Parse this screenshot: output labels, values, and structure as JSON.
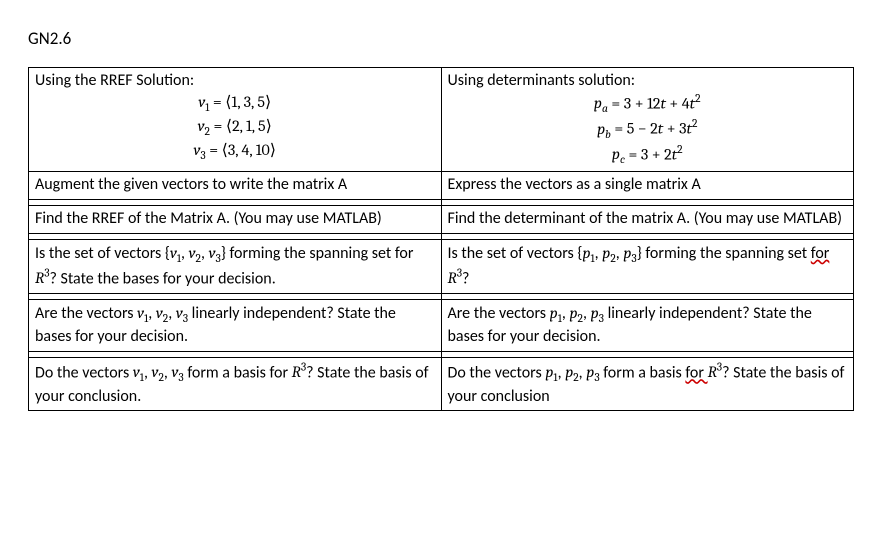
{
  "title": "GN2.6",
  "left": {
    "header_lead": "Using the RREF Solution:",
    "eq1_lhs": "v",
    "eq1_sub": "1",
    "eq1_rhs": " = ⟨1, 3, 5⟩",
    "eq2_lhs": "v",
    "eq2_sub": "2",
    "eq2_rhs": " = ⟨2, 1, 5⟩",
    "eq3_lhs": "v",
    "eq3_sub": "3",
    "eq3_rhs": " = ⟨3, 4, 10⟩",
    "row2": "Augment the given vectors to write the matrix A",
    "row3": "Find the RREF of the Matrix A. (You may use MATLAB)",
    "row4_pre": "Is the set of vectors ",
    "row4_set_open": "{",
    "row4_v1": "v",
    "row4_v1_sub": "1",
    "row4_sep": ", ",
    "row4_v2": "v",
    "row4_v2_sub": "2",
    "row4_v3": "v",
    "row4_v3_sub": "3",
    "row4_set_close": "}",
    "row4_post1": "  forming the spanning set for ",
    "row4_R": "R",
    "row4_R_sup": "3",
    "row4_post2": "? State the bases for your decision.",
    "row5_pre": "Are the vectors ",
    "row5_post": " linearly independent? State the bases for your decision.",
    "row6_pre": "Do the vectors ",
    "row6_mid": " form a basis for ",
    "row6_post": "? State the basis of your conclusion."
  },
  "right": {
    "header_lead": "Using determinants solution:",
    "eq1_lhs": "p",
    "eq1_sub": "a",
    "eq1_rhs_a": " = 3 + 12",
    "eq1_t1": "t",
    "eq1_rhs_b": " + 4",
    "eq1_t2": "t",
    "eq1_sup": "2",
    "eq2_lhs": "p",
    "eq2_sub": "b",
    "eq2_rhs_a": " = 5 − 2",
    "eq2_t1": "t",
    "eq2_rhs_b": " + 3",
    "eq2_t2": "t",
    "eq2_sup": "2",
    "eq3_lhs": "p",
    "eq3_sub": "c",
    "eq3_rhs_a": " = 3 + 2",
    "eq3_t1": "t",
    "eq3_sup": "2",
    "row2": "Express the vectors as a single matrix A",
    "row3": "Find the determinant of the matrix A. (You may use MATLAB)",
    "row4_pre": "Is the set of vectors ",
    "row4_set_open": "{",
    "row4_p1": "p",
    "row4_p1_sub": "1",
    "row4_sep": ", ",
    "row4_p2": "p",
    "row4_p2_sub": "2",
    "row4_p3": "p",
    "row4_p3_sub": "3",
    "row4_set_close": "}",
    "row4_post1": " forming the spanning set ",
    "row4_for": "for ",
    "row4_R": "R",
    "row4_R_sup": "3",
    "row4_post2": "?",
    "row5_pre": "Are the vectors ",
    "row5_post": " linearly independent? State the bases for your decision.",
    "row6_pre": "Do the vectors ",
    "row6_mid": " form a basis ",
    "row6_for": "for ",
    "row6_post": "? State the basis of your conclusion"
  }
}
